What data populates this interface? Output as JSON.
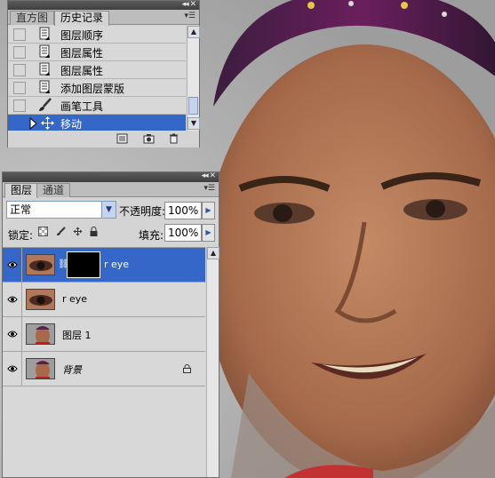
{
  "history_panel": {
    "tabs": [
      {
        "label": "直方图",
        "active": false
      },
      {
        "label": "历史记录",
        "active": true
      }
    ],
    "items": [
      {
        "label": "图层顺序",
        "icon": "history-state-icon",
        "selected": false
      },
      {
        "label": "图层属性",
        "icon": "history-state-icon",
        "selected": false
      },
      {
        "label": "图层属性",
        "icon": "history-state-icon",
        "selected": false
      },
      {
        "label": "添加图层蒙版",
        "icon": "history-state-icon",
        "selected": false
      },
      {
        "label": "画笔工具",
        "icon": "brush-icon",
        "selected": false
      },
      {
        "label": "移动",
        "icon": "move-tool-icon",
        "selected": true
      }
    ]
  },
  "layers_panel": {
    "tabs": [
      {
        "label": "图层",
        "active": true
      },
      {
        "label": "通道",
        "active": false
      }
    ],
    "blend_mode": "正常",
    "opacity_label": "不透明度:",
    "opacity_value": "100%",
    "lock_label": "锁定:",
    "fill_label": "填充:",
    "fill_value": "100%",
    "layers": [
      {
        "name": "r eye",
        "visible": true,
        "selected": true,
        "has_mask": true,
        "italic": false,
        "locked": false,
        "thumb": "eye-closeup"
      },
      {
        "name": "r eye",
        "visible": true,
        "selected": false,
        "has_mask": false,
        "italic": false,
        "locked": false,
        "thumb": "eye-closeup"
      },
      {
        "name": "图层 1",
        "visible": true,
        "selected": false,
        "has_mask": false,
        "italic": false,
        "locked": false,
        "thumb": "portrait"
      },
      {
        "name": "背景",
        "visible": true,
        "selected": false,
        "has_mask": false,
        "italic": true,
        "locked": true,
        "thumb": "portrait"
      }
    ]
  },
  "colors": {
    "selection": "#3567c9",
    "panel_bg": "#d4d4d4",
    "titlebar": "#4a4a4a"
  }
}
